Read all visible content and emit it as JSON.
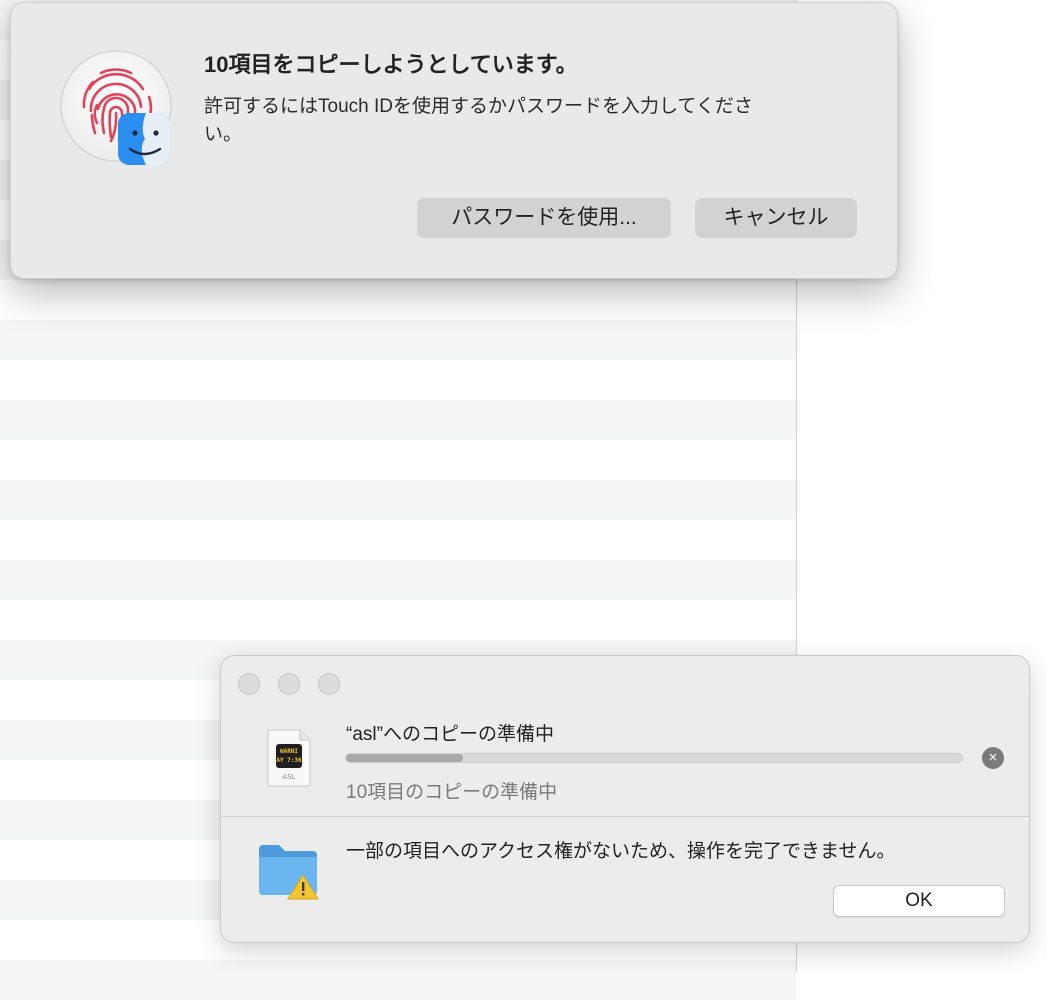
{
  "auth_dialog": {
    "title": "10項目をコピーしようとしています。",
    "message": "許可するにはTouch IDを使用するかパスワードを入力してください。",
    "use_password_label": "パスワードを使用...",
    "cancel_label": "キャンセル",
    "icon": "touch-id-fingerprint-icon",
    "badge_icon": "finder-icon",
    "fingerprint_color": "#e2435a"
  },
  "copy_window": {
    "title": "“asl”へのコピーの準備中",
    "file_icon_label": "ASL",
    "file_preview_text": "WARNI\nAY 7:36",
    "progress": 0.19,
    "status": "10項目のコピーの準備中",
    "error_message": "一部の項目へのアクセス権がないため、操作を完了できません。",
    "ok_label": "OK",
    "stop_icon": "×",
    "folder_color": "#5aa9e6",
    "warning_color": "#f2c531"
  }
}
